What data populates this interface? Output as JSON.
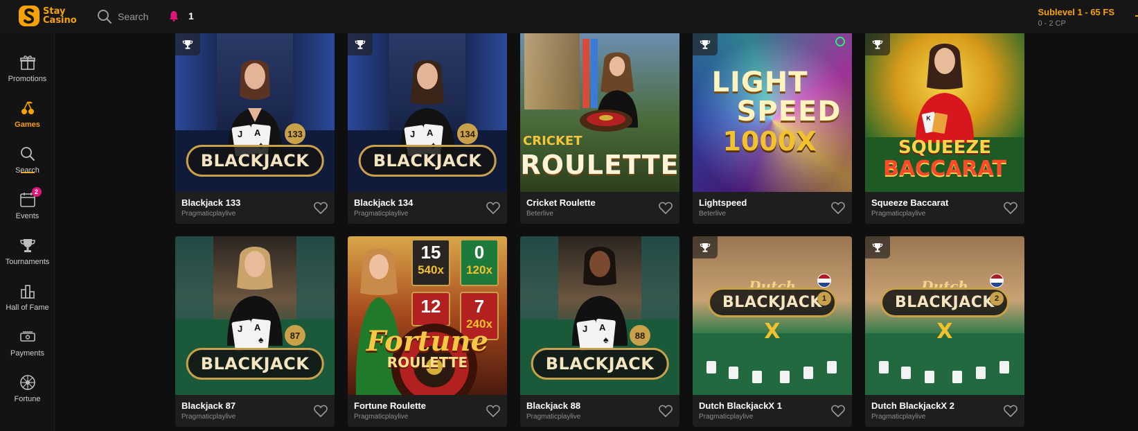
{
  "brand": {
    "line1": "Stay",
    "line2": "Casino"
  },
  "topbar": {
    "search_label": "Search",
    "notifications_count": "1",
    "level_title": "Sublevel 1 - 65 FS",
    "level_points": "0 - 2 CP"
  },
  "sidebar": {
    "items": [
      {
        "label": "Promotions",
        "icon": "gift-icon"
      },
      {
        "label": "Games",
        "icon": "cherries-icon"
      },
      {
        "label": "Search",
        "icon": "search-icon"
      },
      {
        "label": "Events",
        "icon": "calendar-icon",
        "badge": "2"
      },
      {
        "label": "Tournaments",
        "icon": "trophy-icon"
      },
      {
        "label": "Hall of Fame",
        "icon": "podium-icon"
      },
      {
        "label": "Payments",
        "icon": "wallet-icon"
      },
      {
        "label": "Fortune",
        "icon": "wheel-icon"
      }
    ],
    "active": "Games"
  },
  "games": [
    {
      "name": "Blackjack 133",
      "provider": "Pragmaticplaylive",
      "art_title": "BLACKJACK",
      "art_num": "133"
    },
    {
      "name": "Blackjack 134",
      "provider": "Pragmaticplaylive",
      "art_title": "BLACKJACK",
      "art_num": "134"
    },
    {
      "name": "Cricket Roulette",
      "provider": "Beterlive",
      "art_title": "ROULETTE",
      "art_sub": "CRICKET"
    },
    {
      "name": "Lightspeed",
      "provider": "Beterlive",
      "art_line1": "LIGHT",
      "art_line2": "SPEED",
      "art_line3": "1000X"
    },
    {
      "name": "Squeeze Baccarat",
      "provider": "Pragmaticplaylive",
      "art_line1": "SQUEEZE",
      "art_line2": "BACCARAT"
    },
    {
      "name": "Blackjack 87",
      "provider": "Pragmaticplaylive",
      "art_title": "BLACKJACK",
      "art_num": "87"
    },
    {
      "name": "Fortune Roulette",
      "provider": "Pragmaticplaylive",
      "art_line1": "Fortune",
      "art_line2": "ROULETTE",
      "tiles": [
        "15",
        "0",
        "540x",
        "120x",
        "12",
        "7",
        "240x"
      ]
    },
    {
      "name": "Blackjack 88",
      "provider": "Pragmaticplaylive",
      "art_title": "BLACKJACK",
      "art_num": "88"
    },
    {
      "name": "Dutch BlackjackX 1",
      "provider": "Pragmaticplaylive",
      "art_sub": "Dutch",
      "art_title": "BLACKJACK",
      "art_num": "1",
      "art_x": "X"
    },
    {
      "name": "Dutch BlackjackX 2",
      "provider": "Pragmaticplaylive",
      "art_sub": "Dutch",
      "art_title": "BLACKJACK",
      "art_num": "2",
      "art_x": "X"
    }
  ],
  "colors": {
    "accent": "#f7a200",
    "badge": "#e0157a",
    "live": "#2ee87a"
  }
}
